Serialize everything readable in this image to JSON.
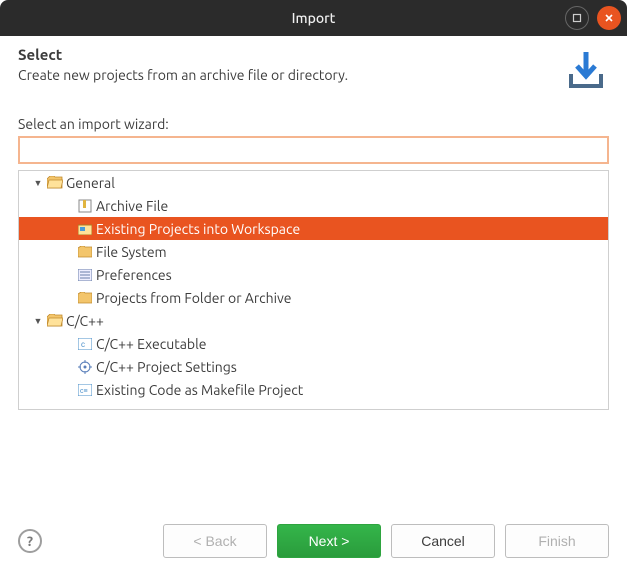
{
  "title": "Import",
  "header": {
    "heading": "Select",
    "description": "Create new projects from an archive file or directory."
  },
  "wizard": {
    "filter_label": "Select an import wizard:",
    "filter_value": "",
    "selected_path": "General/Existing Projects into Workspace",
    "tree": [
      {
        "label": "General",
        "expanded": true,
        "children": [
          {
            "label": "Archive File",
            "icon": "archive"
          },
          {
            "label": "Existing Projects into Workspace",
            "icon": "project",
            "selected": true
          },
          {
            "label": "File System",
            "icon": "folder"
          },
          {
            "label": "Preferences",
            "icon": "prefs"
          },
          {
            "label": "Projects from Folder or Archive",
            "icon": "folder"
          }
        ]
      },
      {
        "label": "C/C++",
        "expanded": true,
        "children": [
          {
            "label": "C/C++ Executable",
            "icon": "c-exec"
          },
          {
            "label": "C/C++ Project Settings",
            "icon": "c-settings"
          },
          {
            "label": "Existing Code as Makefile Project",
            "icon": "c-makefile"
          }
        ]
      }
    ]
  },
  "buttons": {
    "back": {
      "label": "< Back",
      "enabled": false
    },
    "next": {
      "label": "Next >",
      "enabled": true
    },
    "cancel": {
      "label": "Cancel",
      "enabled": true
    },
    "finish": {
      "label": "Finish",
      "enabled": false
    }
  }
}
